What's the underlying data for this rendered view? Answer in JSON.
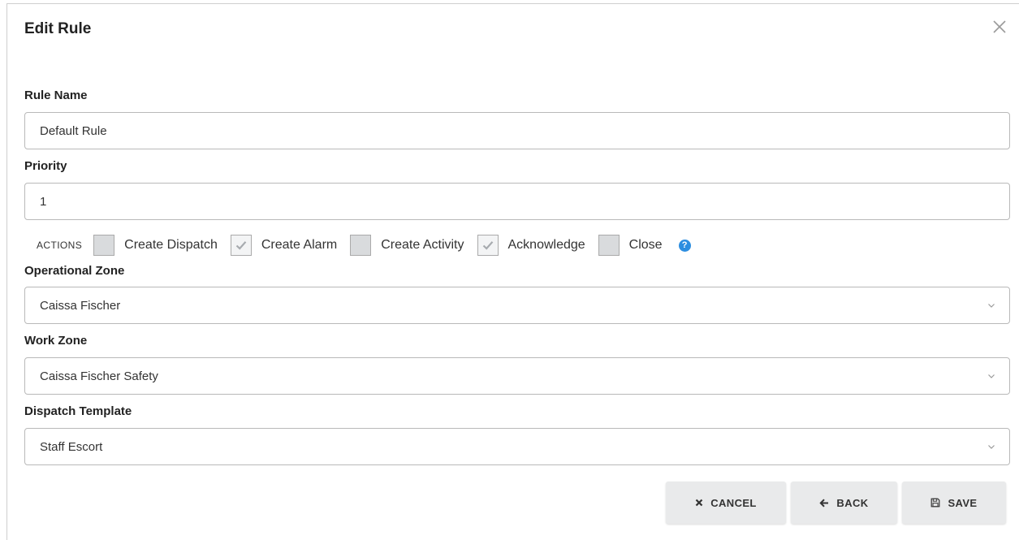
{
  "modal": {
    "title": "Edit Rule",
    "close_icon": "close-icon"
  },
  "fields": {
    "rule_name": {
      "label": "Rule Name",
      "value": "Default Rule"
    },
    "priority": {
      "label": "Priority",
      "value": "1"
    },
    "operational_zone": {
      "label": "Operational Zone",
      "value": "Caissa Fischer"
    },
    "work_zone": {
      "label": "Work Zone",
      "value": "Caissa Fischer Safety"
    },
    "dispatch_template": {
      "label": "Dispatch Template",
      "value": "Staff Escort"
    }
  },
  "actions": {
    "label": "ACTIONS",
    "items": [
      {
        "label": "Create Dispatch",
        "checked": false
      },
      {
        "label": "Create Alarm",
        "checked": true
      },
      {
        "label": "Create Activity",
        "checked": false
      },
      {
        "label": "Acknowledge",
        "checked": true
      },
      {
        "label": "Close",
        "checked": false
      }
    ],
    "help_icon": "question-circle-icon",
    "help_glyph": "?"
  },
  "buttons": {
    "cancel": {
      "label": "CANCEL",
      "icon": "x-icon"
    },
    "back": {
      "label": "BACK",
      "icon": "arrow-left-icon"
    },
    "save": {
      "label": "SAVE",
      "icon": "floppy-disk-icon"
    }
  },
  "colors": {
    "help_blue": "#2d8ee0",
    "button_bg": "#e9eaeb",
    "checkbox_unchecked": "#d9dbdd",
    "checkbox_checked": "#f3f4f5"
  }
}
